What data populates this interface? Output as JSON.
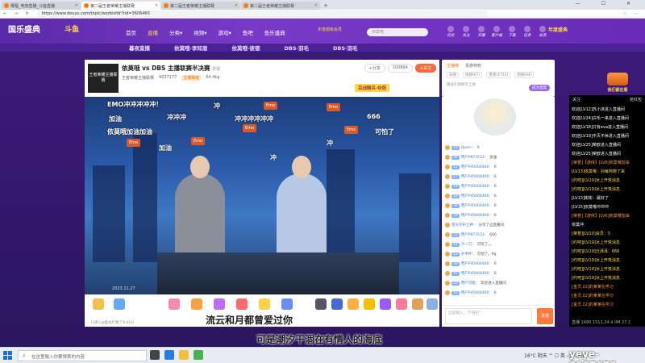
{
  "browser": {
    "tabs": [
      {
        "label": "赛程_电竞直播_斗鱼直播"
      },
      {
        "label": "第二届王者荣耀主播联赛"
      },
      {
        "label": "第二届王者荣耀主播联赛"
      },
      {
        "label": "第二届王者荣耀主播联赛"
      }
    ],
    "url": "https://www.douyu.com/topic/wzzblsfdr?rid=3606460",
    "controls": "—  ☐  ✕"
  },
  "site": {
    "logo": "国乐盛典",
    "logo_sub": "斗鱼",
    "nav": [
      "首页",
      "直播",
      "分类▾",
      "视频▾",
      "游戏▾",
      "鱼吧",
      "鱼乐盛典"
    ],
    "vip_label": "年度超级会员",
    "search_placeholder": "依莫哦",
    "toolbar": [
      "历史",
      "关注",
      "开播",
      "客户端",
      "下载",
      "任务",
      "会员"
    ],
    "banner": "年度盛典"
  },
  "strip": [
    "暮夜直播",
    "依莫哦·李知恩",
    "依莫哦·彼德",
    "DBS·羽毛",
    "DBS·羽毛"
  ],
  "room": {
    "avatar_text": "王者荣耀主播联赛",
    "title": "依莫哦 vs DBS 主播联赛半决赛",
    "tag": "举报",
    "meta": [
      "王者荣耀主播联赛",
      "4037177",
      "主播等级",
      "64.4kg"
    ],
    "btn_share": "+分享",
    "btn_count": "100864",
    "btn_follow": "+关注",
    "slogan": "百战精兵·夺冠"
  },
  "danmaku": [
    "EMO冲冲冲冲冲！",
    "冲",
    "加油",
    "冲冲冲",
    "冲冲冲冲冲冲",
    "依莫哦加油加油",
    "666",
    "可怕了",
    "冲",
    "加油",
    "冲"
  ],
  "emo_stickers": [
    "Emo",
    "Emo",
    "Emo",
    "Emo",
    "Emo",
    "Emo"
  ],
  "video": {
    "timestamp": "2023.11.27"
  },
  "gifts": [
    "",
    "",
    "",
    "",
    "",
    "",
    "",
    "",
    "",
    "",
    "",
    "",
    "",
    "",
    "",
    "",
    "",
    ""
  ],
  "gift_footer": "[2条] @鱼丸打扰了9.4(2)",
  "rank": {
    "tabs": [
      "主播榜",
      "贵族特权"
    ],
    "sub": [
      "日榜",
      "周榜(67)",
      "贵宾(4721)",
      "周榜(64)"
    ],
    "tip": "赠送礼物即可上榜",
    "btn": "成为贵宾"
  },
  "chat": [
    {
      "lv": "24",
      "name": "Open-",
      "text": "6"
    },
    {
      "lv": "36",
      "name": "用户P973533",
      "text": "加油"
    },
    {
      "lv": "12",
      "name": "用户P45004400",
      "text": "6"
    },
    {
      "lv": "27",
      "name": "用户P45004400",
      "text": "6"
    },
    {
      "lv": "18",
      "name": "用户P45004400",
      "text": "6"
    },
    {
      "lv": "18",
      "name": "用户P45004400",
      "text": "6"
    },
    {
      "lv": "30",
      "name": "用户P45004400",
      "text": "6"
    },
    {
      "lv": "19",
      "name": "用户P45004400",
      "text": "6"
    },
    {
      "lv": "",
      "name": "星光守护之神",
      "text": "分享了这直播间"
    },
    {
      "lv": "22",
      "name": "用户P973533",
      "text": "666"
    },
    {
      "lv": "22",
      "name": "冷一刀",
      "text": "可玩了。。"
    },
    {
      "lv": "13",
      "name": "水半杯",
      "text": "可怕了。9g"
    },
    {
      "lv": "30",
      "name": "用户P45004400",
      "text": "6"
    },
    {
      "lv": "31",
      "name": "用户P45004400",
      "text": "6"
    },
    {
      "lv": "20",
      "name": "用户可能",
      "text": "欢迎进入直播间"
    },
    {
      "lv": "16",
      "name": "用户P45004400",
      "text": "6"
    }
  ],
  "chat_input": {
    "placeholder": "这里输入，\"不冒犯\"",
    "send": "发送"
  },
  "promo": "我们都在看",
  "overlay": {
    "top_left": "关注",
    "top_right": "抢红包",
    "lines": [
      "欢迎[LV12]苏小沫进入直播间",
      "欢迎[LV24]白毛一来进入直播间",
      "欢迎[LV18]只有eva进入直播间",
      "欢迎[LV19]不灭不休进入直播间",
      "欢迎[LV25]荣欧进入直播间",
      "欢迎[LV25]荣欧进入直播间",
      "[荣誉]【游侠】[LV6]依莫哦加油",
      "[LV13]依莫哦：别每阿随了来",
      "[约吧][LV19]冰上开荒消息",
      "[约吧][LV19]冰上开荒消息",
      "[LV13]彬彬：最好了",
      "[LV15]依莫哦冲冲冲",
      "[荣誉]【游侠】[LV6]依莫哦加油",
      "依莫冲",
      "[荣誉][LV10]会员：5",
      "[约吧][LV19]冰上开荒消息",
      "[约吧][LV19]泛湃湃：666",
      "[约吧][LV19]冰上开荒消息",
      "[约吧][LV19]冰上开荒消息",
      "[约吧][LV19]冰上开荒消息",
      "[金灵.22]的某某在学习",
      "[金灵.22]的某某在学习",
      "[金灵.22]的某某在学习"
    ],
    "footer": "直播 1480 1511.24 4.0M 27.1"
  },
  "subtitles": {
    "line1": "流云和月都曾爱过你",
    "line2": "可是潮汐干涸在有情人的海底"
  },
  "taskbar": {
    "search_placeholder": "在这里输入你要搜索的内容",
    "tray": "16°C 阴天 ^ ☐ 英 ◁ 21:10"
  },
  "watermark": "yeye-8967678",
  "colors": {
    "site_purple": "#5a2aa8",
    "accent_orange": "#ff6a3d",
    "gold": "#ffd84a"
  }
}
